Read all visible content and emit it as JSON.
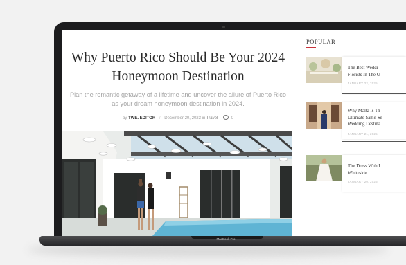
{
  "device": {
    "model_label": "MacBook Pro"
  },
  "article": {
    "title_line1": "Why Puerto Rico Should Be Your 2024",
    "title_line2": "Honeymoon Destination",
    "subtitle": "Plan the romantic getaway of a lifetime and uncover the allure of Puerto Rico as your dream honeymoon destination in 2024.",
    "meta": {
      "by": "by",
      "author": "TWE. EDITOR",
      "date": "December 20, 2023",
      "in": "in",
      "category": "Travel",
      "comments": "0"
    }
  },
  "sidebar": {
    "heading": "POPULAR",
    "items": [
      {
        "title": "The Best Weddi\nFlorists In The U",
        "date": "JANUARY 22, 2025"
      },
      {
        "title": "Why Malta Is Th\nUltimate Same-Se\nWedding Destina",
        "date": "JANUARY 21, 2025"
      },
      {
        "title": "The Dress With I\nWhiteside",
        "date": "JANUARY 20, 2025"
      }
    ]
  },
  "colors": {
    "accent": "#c9333c",
    "pool": "#5fb4d4",
    "bezel": "#1c1c1e"
  }
}
